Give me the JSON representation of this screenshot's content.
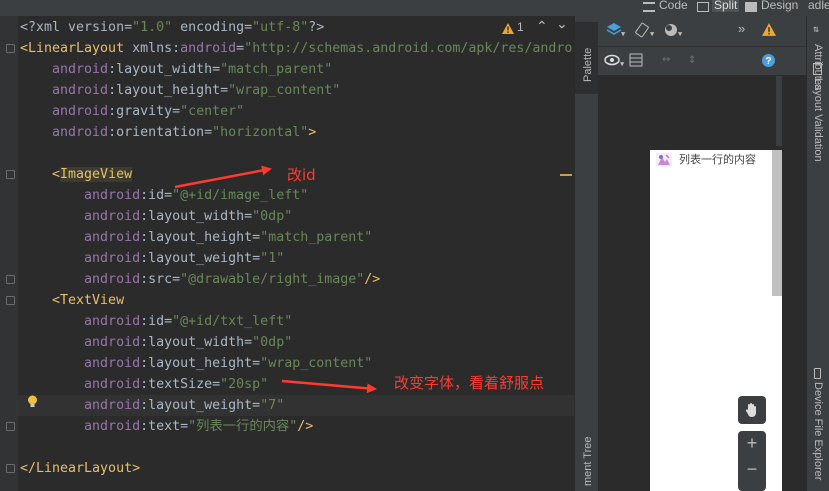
{
  "window": {
    "modes": {
      "code": "Code",
      "split": "Split",
      "design": "Design"
    },
    "cut_tab": "adle"
  },
  "editor": {
    "lines": [
      {
        "parts": [
          {
            "t": "<?xml version=",
            "c": "plain"
          },
          {
            "t": "\"1.0\"",
            "c": "attrv"
          },
          {
            "t": " encoding=",
            "c": "plain"
          },
          {
            "t": "\"utf-8\"",
            "c": "attrv"
          },
          {
            "t": "?>",
            "c": "plain"
          }
        ]
      },
      {
        "parts": [
          {
            "t": "<LinearLayout ",
            "c": "tag"
          },
          {
            "t": "xmlns:",
            "c": "plain"
          },
          {
            "t": "android",
            "c": "attrn"
          },
          {
            "t": "=",
            "c": "plain"
          },
          {
            "t": "\"http://schemas.android.com/apk/res/andro",
            "c": "attrv"
          }
        ]
      },
      {
        "parts": [
          {
            "t": "    android",
            "c": "attrn"
          },
          {
            "t": ":layout_width=",
            "c": "plain"
          },
          {
            "t": "\"match_parent\"",
            "c": "attrv"
          }
        ]
      },
      {
        "parts": [
          {
            "t": "    android",
            "c": "attrn"
          },
          {
            "t": ":layout_height=",
            "c": "plain"
          },
          {
            "t": "\"wrap_content\"",
            "c": "attrv"
          }
        ]
      },
      {
        "parts": [
          {
            "t": "    android",
            "c": "attrn"
          },
          {
            "t": ":gravity=",
            "c": "plain"
          },
          {
            "t": "\"center\"",
            "c": "attrv"
          }
        ]
      },
      {
        "parts": [
          {
            "t": "    android",
            "c": "attrn"
          },
          {
            "t": ":orientation=",
            "c": "plain"
          },
          {
            "t": "\"horizontal\"",
            "c": "attrv"
          },
          {
            "t": ">",
            "c": "tag"
          }
        ]
      },
      {
        "parts": []
      },
      {
        "parts": [
          {
            "t": "    <",
            "c": "tag"
          },
          {
            "t": "ImageView",
            "c": "hl"
          }
        ]
      },
      {
        "parts": [
          {
            "t": "        android",
            "c": "attrn"
          },
          {
            "t": ":id=",
            "c": "plain"
          },
          {
            "t": "\"@+id/image_left\"",
            "c": "attrv"
          }
        ]
      },
      {
        "parts": [
          {
            "t": "        android",
            "c": "attrn"
          },
          {
            "t": ":layout_width=",
            "c": "plain"
          },
          {
            "t": "\"0dp\"",
            "c": "attrv"
          }
        ]
      },
      {
        "parts": [
          {
            "t": "        android",
            "c": "attrn"
          },
          {
            "t": ":layout_height=",
            "c": "plain"
          },
          {
            "t": "\"match_parent\"",
            "c": "attrv"
          }
        ]
      },
      {
        "parts": [
          {
            "t": "        android",
            "c": "attrn"
          },
          {
            "t": ":layout_weight=",
            "c": "plain"
          },
          {
            "t": "\"1\"",
            "c": "attrv"
          }
        ]
      },
      {
        "parts": [
          {
            "t": "        android",
            "c": "attrn"
          },
          {
            "t": ":src=",
            "c": "plain"
          },
          {
            "t": "\"@drawable/right_image\"",
            "c": "attrv"
          },
          {
            "t": "/>",
            "c": "tag"
          }
        ]
      },
      {
        "parts": [
          {
            "t": "    <TextView",
            "c": "tag"
          }
        ]
      },
      {
        "parts": [
          {
            "t": "        android",
            "c": "attrn"
          },
          {
            "t": ":id=",
            "c": "plain"
          },
          {
            "t": "\"@+id/txt_left\"",
            "c": "attrv"
          }
        ]
      },
      {
        "parts": [
          {
            "t": "        android",
            "c": "attrn"
          },
          {
            "t": ":layout_width=",
            "c": "plain"
          },
          {
            "t": "\"0dp\"",
            "c": "attrv"
          }
        ]
      },
      {
        "parts": [
          {
            "t": "        android",
            "c": "attrn"
          },
          {
            "t": ":layout_height=",
            "c": "plain"
          },
          {
            "t": "\"wrap_content\"",
            "c": "attrv"
          }
        ]
      },
      {
        "parts": [
          {
            "t": "        android",
            "c": "attrn"
          },
          {
            "t": ":textSize=",
            "c": "plain"
          },
          {
            "t": "\"20sp\"",
            "c": "attrv"
          }
        ]
      },
      {
        "parts": [
          {
            "t": "        android",
            "c": "attrn"
          },
          {
            "t": ":layout_weight=",
            "c": "plain"
          },
          {
            "t": "\"7\"",
            "c": "attrv"
          }
        ]
      },
      {
        "parts": [
          {
            "t": "        android",
            "c": "attrn"
          },
          {
            "t": ":text=",
            "c": "plain"
          },
          {
            "t": "\"列表一行的内容\"",
            "c": "attrv"
          },
          {
            "t": "/>",
            "c": "tag"
          }
        ]
      },
      {
        "parts": []
      },
      {
        "parts": [
          {
            "t": "</LinearLayout>",
            "c": "tag"
          }
        ]
      }
    ],
    "warning_count": "1"
  },
  "side_tabs": {
    "palette": "Palette",
    "component_tree": "ment Tree",
    "attributes": "Attributes",
    "layout_validation": "Layout Validation",
    "device_file_explorer": "Device File Explorer"
  },
  "preview": {
    "row_text": "列表一行的内容",
    "zoom_in": "+",
    "zoom_out": "−"
  },
  "annotations": {
    "change_id": "改id",
    "change_font": "改变字体，看着舒服点"
  },
  "colors": {
    "tag": "#e8bf6a",
    "attr_name": "#9876aa",
    "attr_value": "#6a8759",
    "annotation": "#ff3b30",
    "warning": "#f0a732"
  }
}
